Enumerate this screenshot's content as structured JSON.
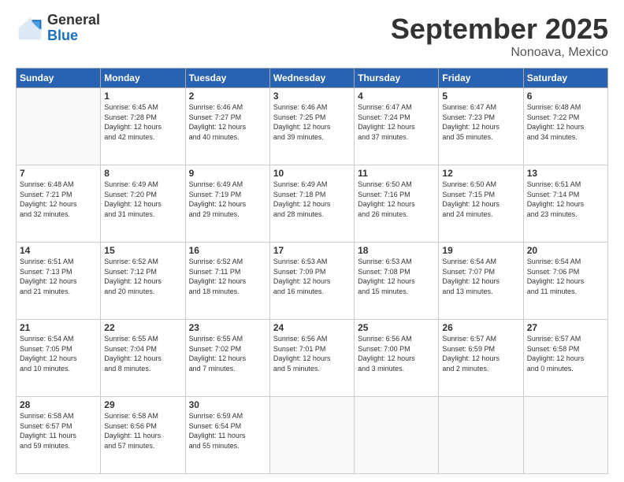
{
  "logo": {
    "general": "General",
    "blue": "Blue"
  },
  "title": {
    "month_year": "September 2025",
    "location": "Nonoava, Mexico"
  },
  "days_header": [
    "Sunday",
    "Monday",
    "Tuesday",
    "Wednesday",
    "Thursday",
    "Friday",
    "Saturday"
  ],
  "weeks": [
    [
      {
        "num": "",
        "info": ""
      },
      {
        "num": "1",
        "info": "Sunrise: 6:45 AM\nSunset: 7:28 PM\nDaylight: 12 hours\nand 42 minutes."
      },
      {
        "num": "2",
        "info": "Sunrise: 6:46 AM\nSunset: 7:27 PM\nDaylight: 12 hours\nand 40 minutes."
      },
      {
        "num": "3",
        "info": "Sunrise: 6:46 AM\nSunset: 7:25 PM\nDaylight: 12 hours\nand 39 minutes."
      },
      {
        "num": "4",
        "info": "Sunrise: 6:47 AM\nSunset: 7:24 PM\nDaylight: 12 hours\nand 37 minutes."
      },
      {
        "num": "5",
        "info": "Sunrise: 6:47 AM\nSunset: 7:23 PM\nDaylight: 12 hours\nand 35 minutes."
      },
      {
        "num": "6",
        "info": "Sunrise: 6:48 AM\nSunset: 7:22 PM\nDaylight: 12 hours\nand 34 minutes."
      }
    ],
    [
      {
        "num": "7",
        "info": "Sunrise: 6:48 AM\nSunset: 7:21 PM\nDaylight: 12 hours\nand 32 minutes."
      },
      {
        "num": "8",
        "info": "Sunrise: 6:49 AM\nSunset: 7:20 PM\nDaylight: 12 hours\nand 31 minutes."
      },
      {
        "num": "9",
        "info": "Sunrise: 6:49 AM\nSunset: 7:19 PM\nDaylight: 12 hours\nand 29 minutes."
      },
      {
        "num": "10",
        "info": "Sunrise: 6:49 AM\nSunset: 7:18 PM\nDaylight: 12 hours\nand 28 minutes."
      },
      {
        "num": "11",
        "info": "Sunrise: 6:50 AM\nSunset: 7:16 PM\nDaylight: 12 hours\nand 26 minutes."
      },
      {
        "num": "12",
        "info": "Sunrise: 6:50 AM\nSunset: 7:15 PM\nDaylight: 12 hours\nand 24 minutes."
      },
      {
        "num": "13",
        "info": "Sunrise: 6:51 AM\nSunset: 7:14 PM\nDaylight: 12 hours\nand 23 minutes."
      }
    ],
    [
      {
        "num": "14",
        "info": "Sunrise: 6:51 AM\nSunset: 7:13 PM\nDaylight: 12 hours\nand 21 minutes."
      },
      {
        "num": "15",
        "info": "Sunrise: 6:52 AM\nSunset: 7:12 PM\nDaylight: 12 hours\nand 20 minutes."
      },
      {
        "num": "16",
        "info": "Sunrise: 6:52 AM\nSunset: 7:11 PM\nDaylight: 12 hours\nand 18 minutes."
      },
      {
        "num": "17",
        "info": "Sunrise: 6:53 AM\nSunset: 7:09 PM\nDaylight: 12 hours\nand 16 minutes."
      },
      {
        "num": "18",
        "info": "Sunrise: 6:53 AM\nSunset: 7:08 PM\nDaylight: 12 hours\nand 15 minutes."
      },
      {
        "num": "19",
        "info": "Sunrise: 6:54 AM\nSunset: 7:07 PM\nDaylight: 12 hours\nand 13 minutes."
      },
      {
        "num": "20",
        "info": "Sunrise: 6:54 AM\nSunset: 7:06 PM\nDaylight: 12 hours\nand 11 minutes."
      }
    ],
    [
      {
        "num": "21",
        "info": "Sunrise: 6:54 AM\nSunset: 7:05 PM\nDaylight: 12 hours\nand 10 minutes."
      },
      {
        "num": "22",
        "info": "Sunrise: 6:55 AM\nSunset: 7:04 PM\nDaylight: 12 hours\nand 8 minutes."
      },
      {
        "num": "23",
        "info": "Sunrise: 6:55 AM\nSunset: 7:02 PM\nDaylight: 12 hours\nand 7 minutes."
      },
      {
        "num": "24",
        "info": "Sunrise: 6:56 AM\nSunset: 7:01 PM\nDaylight: 12 hours\nand 5 minutes."
      },
      {
        "num": "25",
        "info": "Sunrise: 6:56 AM\nSunset: 7:00 PM\nDaylight: 12 hours\nand 3 minutes."
      },
      {
        "num": "26",
        "info": "Sunrise: 6:57 AM\nSunset: 6:59 PM\nDaylight: 12 hours\nand 2 minutes."
      },
      {
        "num": "27",
        "info": "Sunrise: 6:57 AM\nSunset: 6:58 PM\nDaylight: 12 hours\nand 0 minutes."
      }
    ],
    [
      {
        "num": "28",
        "info": "Sunrise: 6:58 AM\nSunset: 6:57 PM\nDaylight: 11 hours\nand 59 minutes."
      },
      {
        "num": "29",
        "info": "Sunrise: 6:58 AM\nSunset: 6:56 PM\nDaylight: 11 hours\nand 57 minutes."
      },
      {
        "num": "30",
        "info": "Sunrise: 6:59 AM\nSunset: 6:54 PM\nDaylight: 11 hours\nand 55 minutes."
      },
      {
        "num": "",
        "info": ""
      },
      {
        "num": "",
        "info": ""
      },
      {
        "num": "",
        "info": ""
      },
      {
        "num": "",
        "info": ""
      }
    ]
  ]
}
